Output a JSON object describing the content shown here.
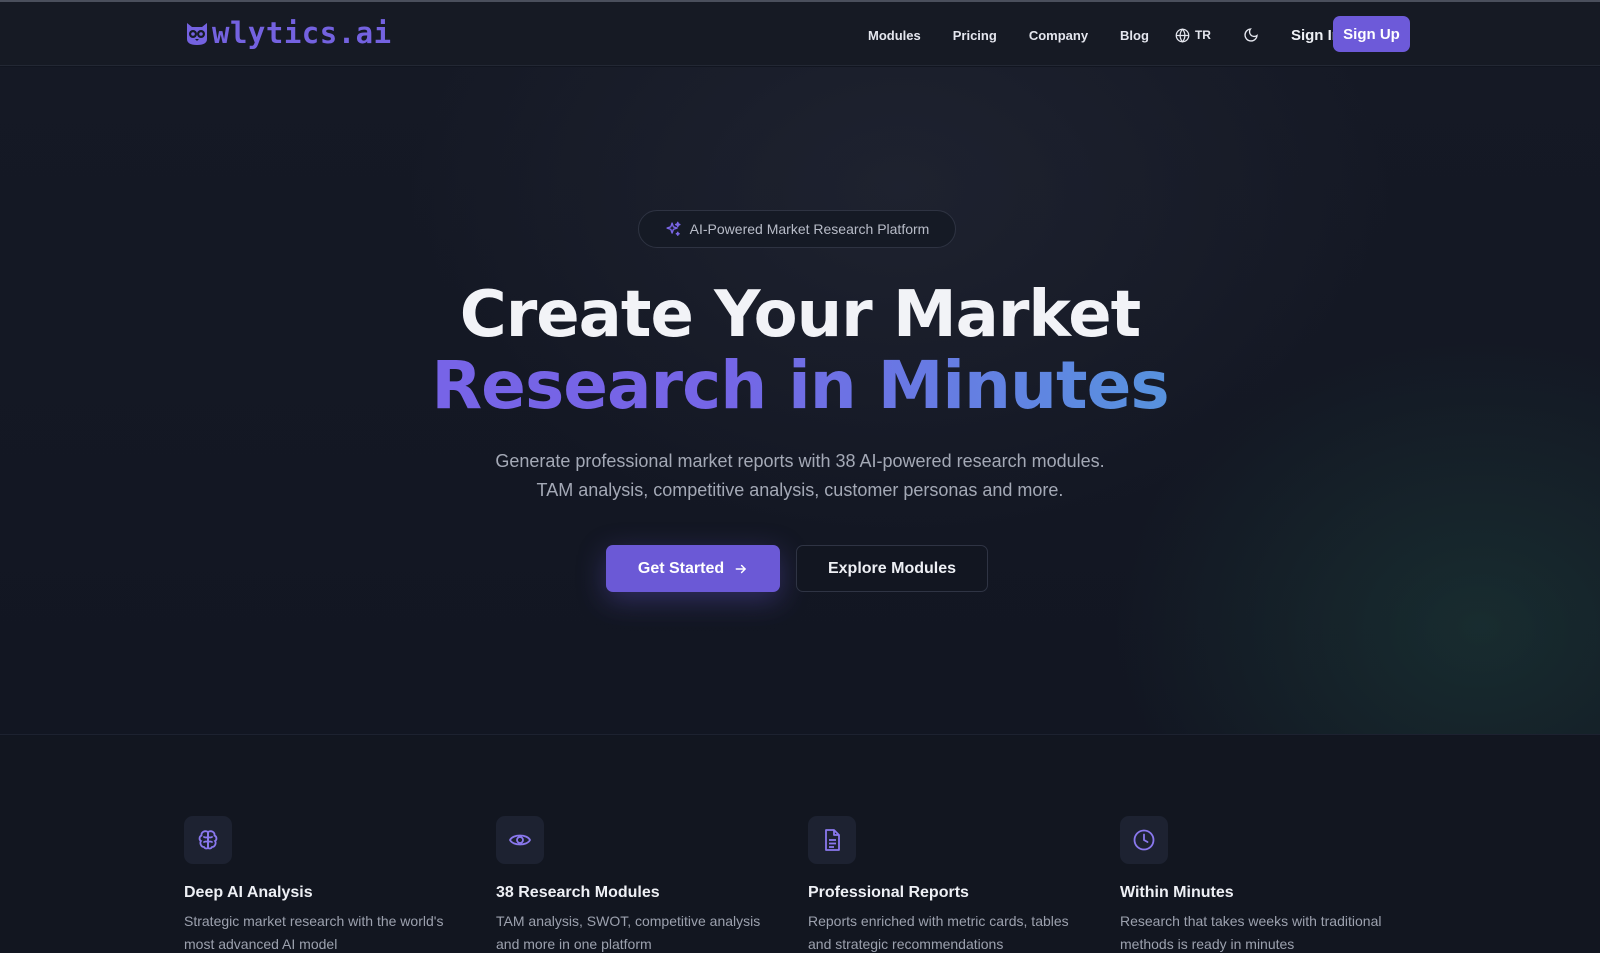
{
  "brand": {
    "name": "wlytics.ai",
    "accent": "#7462e0"
  },
  "nav": {
    "links": [
      "Modules",
      "Pricing",
      "Company",
      "Blog"
    ],
    "language": "TR",
    "language_icon": "globe-icon",
    "theme_icon": "moon-icon",
    "sign_in": "Sign In",
    "sign_up": "Sign Up"
  },
  "hero": {
    "badge": "AI-Powered Market Research Platform",
    "badge_icon": "sparkles-icon",
    "title_line1": "Create Your Market",
    "title_line2": "Research in Minutes",
    "subtitle_line1": "Generate professional market reports with 38 AI-powered research modules.",
    "subtitle_line2": "TAM analysis, competitive analysis, customer personas and more.",
    "primary_cta": "Get Started",
    "secondary_cta": "Explore Modules",
    "primary_color": "#6b59d6",
    "gradient_colors": [
      "#7a62e8",
      "#3cb6c7"
    ]
  },
  "features": [
    {
      "icon": "brain-icon",
      "title": "Deep AI Analysis",
      "desc_line1": "Strategic market research with the world's",
      "desc_line2": "most advanced AI model"
    },
    {
      "icon": "eye-icon",
      "title": "38 Research Modules",
      "desc_line1": "TAM analysis, SWOT, competitive analysis",
      "desc_line2": "and more in one platform"
    },
    {
      "icon": "document-icon",
      "title": "Professional Reports",
      "desc_line1": "Reports enriched with metric cards, tables",
      "desc_line2": "and strategic recommendations"
    },
    {
      "icon": "clock-icon",
      "title": "Within Minutes",
      "desc_line1": "Research that takes weeks with traditional",
      "desc_line2": "methods is ready in minutes"
    }
  ]
}
